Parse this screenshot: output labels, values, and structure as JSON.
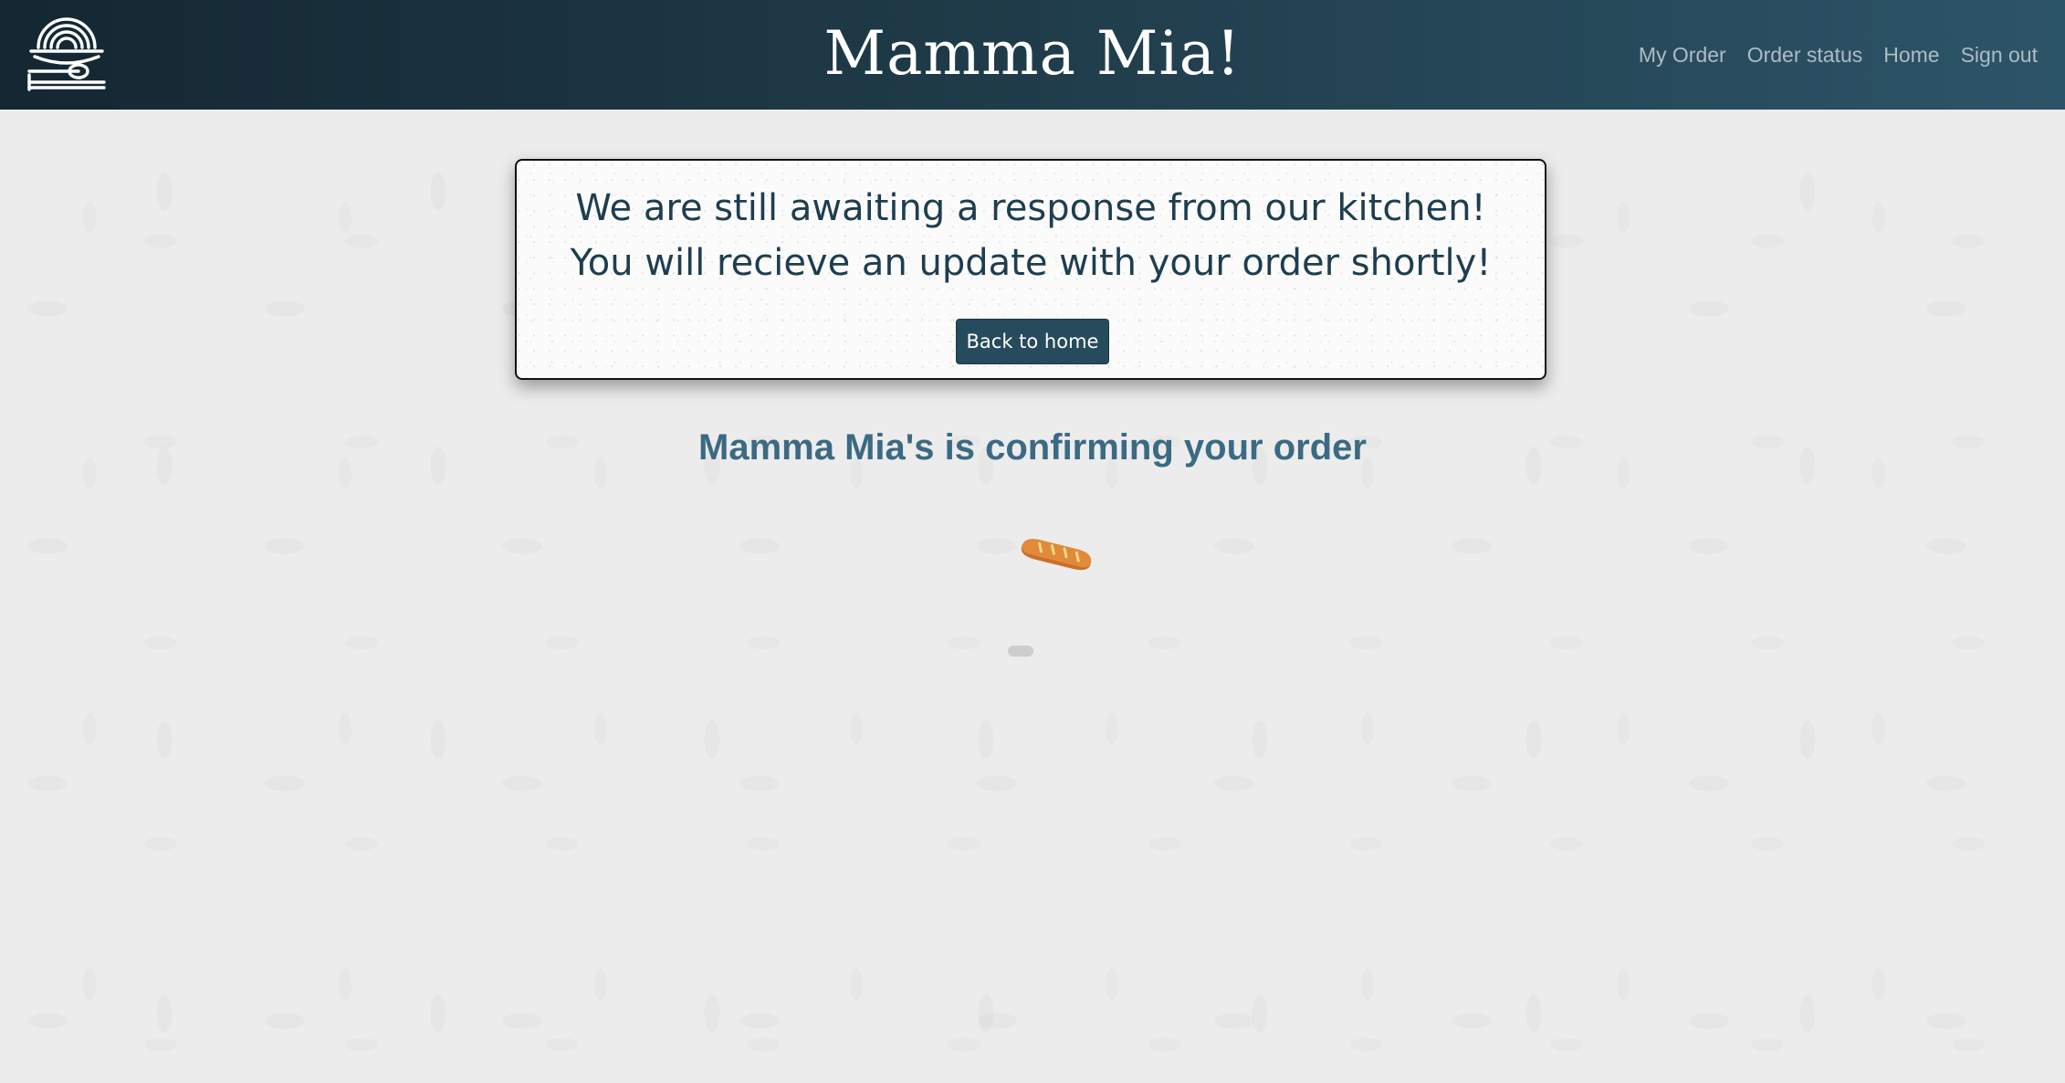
{
  "header": {
    "brand": "Mamma Mia!",
    "logo_icon": "pasta-plate-logo-icon",
    "nav": [
      {
        "label": "My Order"
      },
      {
        "label": "Order status"
      },
      {
        "label": "Home"
      },
      {
        "label": "Sign out"
      }
    ]
  },
  "card": {
    "message": "We are still awaiting a response from our kitchen! You will recieve an update with your order shortly!",
    "button_label": "Back to home"
  },
  "status": {
    "heading": "Mamma Mia's is confirming your order",
    "loading_icon": "bread-loading-icon"
  },
  "colors": {
    "header_dark": "#142732",
    "header_light": "#2c5468",
    "card_text": "#1e3e4f",
    "button_bg": "#264b5d",
    "status_text": "#3b6a83",
    "bread": "#e08a3a",
    "page_bg": "#ececec"
  }
}
